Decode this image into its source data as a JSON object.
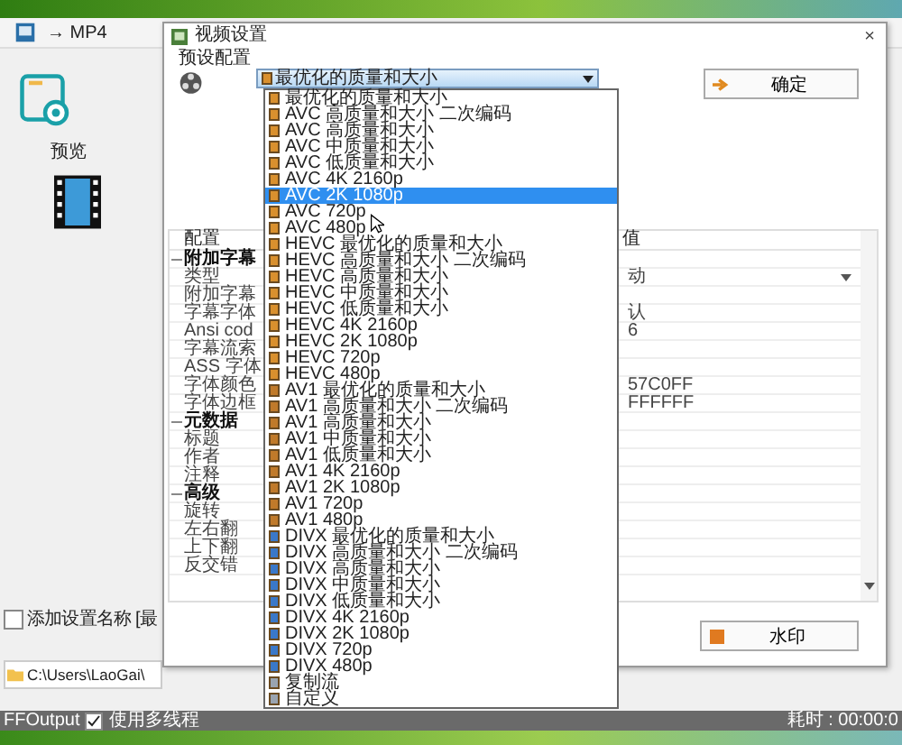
{
  "app": {
    "title": "→ MP4",
    "preview_label": "预览",
    "add_name_option": {
      "label": "添加设置名称 [最",
      "checked": false
    },
    "output_path": "C:\\Users\\LaoGai\\"
  },
  "dialog": {
    "title": "视频设置",
    "close": "×",
    "preset_group": "预设配置",
    "preset": {
      "value": "最优化的质量和大小",
      "expanded": true
    },
    "options": [
      {
        "label": "最优化的质量和大小",
        "color": "#d9902e",
        "selected": false
      },
      {
        "label": "AVC 高质量和大小 二次编码",
        "color": "#d9902e",
        "selected": false
      },
      {
        "label": "AVC 高质量和大小",
        "color": "#d9902e",
        "selected": false
      },
      {
        "label": "AVC 中质量和大小",
        "color": "#d9902e",
        "selected": false
      },
      {
        "label": "AVC 低质量和大小",
        "color": "#d9902e",
        "selected": false
      },
      {
        "label": "AVC 4K 2160p",
        "color": "#d9902e",
        "selected": false
      },
      {
        "label": "AVC 2K 1080p",
        "color": "#d9902e",
        "selected": true
      },
      {
        "label": "AVC 720p",
        "color": "#d9902e",
        "selected": false
      },
      {
        "label": "AVC 480p",
        "color": "#d9902e",
        "selected": false
      },
      {
        "label": "HEVC 最优化的质量和大小",
        "color": "#d9902e",
        "selected": false
      },
      {
        "label": "HEVC 高质量和大小 二次编码",
        "color": "#d9902e",
        "selected": false
      },
      {
        "label": "HEVC 高质量和大小",
        "color": "#d9902e",
        "selected": false
      },
      {
        "label": "HEVC 中质量和大小",
        "color": "#d9902e",
        "selected": false
      },
      {
        "label": "HEVC 低质量和大小",
        "color": "#d9902e",
        "selected": false
      },
      {
        "label": "HEVC 4K 2160p",
        "color": "#d9902e",
        "selected": false
      },
      {
        "label": "HEVC 2K 1080p",
        "color": "#d9902e",
        "selected": false
      },
      {
        "label": "HEVC 720p",
        "color": "#d9902e",
        "selected": false
      },
      {
        "label": "HEVC 480p",
        "color": "#d9902e",
        "selected": false
      },
      {
        "label": "AV1 最优化的质量和大小",
        "color": "#c07a2a",
        "selected": false
      },
      {
        "label": "AV1 高质量和大小 二次编码",
        "color": "#c07a2a",
        "selected": false
      },
      {
        "label": "AV1 高质量和大小",
        "color": "#c07a2a",
        "selected": false
      },
      {
        "label": "AV1 中质量和大小",
        "color": "#c07a2a",
        "selected": false
      },
      {
        "label": "AV1 低质量和大小",
        "color": "#c07a2a",
        "selected": false
      },
      {
        "label": "AV1 4K 2160p",
        "color": "#c07a2a",
        "selected": false
      },
      {
        "label": "AV1 2K 1080p",
        "color": "#c07a2a",
        "selected": false
      },
      {
        "label": "AV1 720p",
        "color": "#c07a2a",
        "selected": false
      },
      {
        "label": "AV1 480p",
        "color": "#c07a2a",
        "selected": false
      },
      {
        "label": "DIVX 最优化的质量和大小",
        "color": "#3a78c8",
        "selected": false
      },
      {
        "label": "DIVX 高质量和大小 二次编码",
        "color": "#3a78c8",
        "selected": false
      },
      {
        "label": "DIVX 高质量和大小",
        "color": "#3a78c8",
        "selected": false
      },
      {
        "label": "DIVX 中质量和大小",
        "color": "#3a78c8",
        "selected": false
      },
      {
        "label": "DIVX 低质量和大小",
        "color": "#3a78c8",
        "selected": false
      },
      {
        "label": "DIVX 4K 2160p",
        "color": "#3a78c8",
        "selected": false
      },
      {
        "label": "DIVX 2K 1080p",
        "color": "#3a78c8",
        "selected": false
      },
      {
        "label": "DIVX 720p",
        "color": "#3a78c8",
        "selected": false
      },
      {
        "label": "DIVX 480p",
        "color": "#3a78c8",
        "selected": false
      },
      {
        "label": "复制流",
        "color": "#9aa4b0",
        "selected": false
      },
      {
        "label": "自定义",
        "color": "#9aa4b0",
        "selected": false
      }
    ],
    "ok_button": "确定",
    "watermark_button": "水印",
    "grid": {
      "columns": [
        "配置",
        "值"
      ],
      "rows": [
        {
          "kind": "group",
          "name": "附加字幕",
          "expanded": true
        },
        {
          "kind": "choice",
          "name": "类型",
          "value": "动"
        },
        {
          "kind": "item",
          "name": "附加字幕"
        },
        {
          "kind": "item",
          "name": "字幕字体",
          "value": "认"
        },
        {
          "kind": "item",
          "name": "Ansi cod",
          "value": "6"
        },
        {
          "kind": "item",
          "name": "字幕流索"
        },
        {
          "kind": "item",
          "name": "ASS 字体"
        },
        {
          "kind": "item",
          "name": "字体颜色",
          "value": "57C0FF"
        },
        {
          "kind": "item",
          "name": "字体边框",
          "value": "FFFFFF"
        },
        {
          "kind": "group",
          "name": "元数据",
          "expanded": true
        },
        {
          "kind": "item",
          "name": "标题"
        },
        {
          "kind": "item",
          "name": "作者"
        },
        {
          "kind": "item",
          "name": "注释"
        },
        {
          "kind": "group",
          "name": "高级",
          "expanded": true
        },
        {
          "kind": "item",
          "name": "旋转"
        },
        {
          "kind": "item",
          "name": "左右翻"
        },
        {
          "kind": "item",
          "name": "上下翻"
        },
        {
          "kind": "item",
          "name": "反交错"
        }
      ]
    }
  },
  "status_bar": {
    "output": "FFOutput",
    "multithread": {
      "label": "使用多线程",
      "checked": true
    },
    "elapsed": "耗时 : 00:00:0"
  }
}
